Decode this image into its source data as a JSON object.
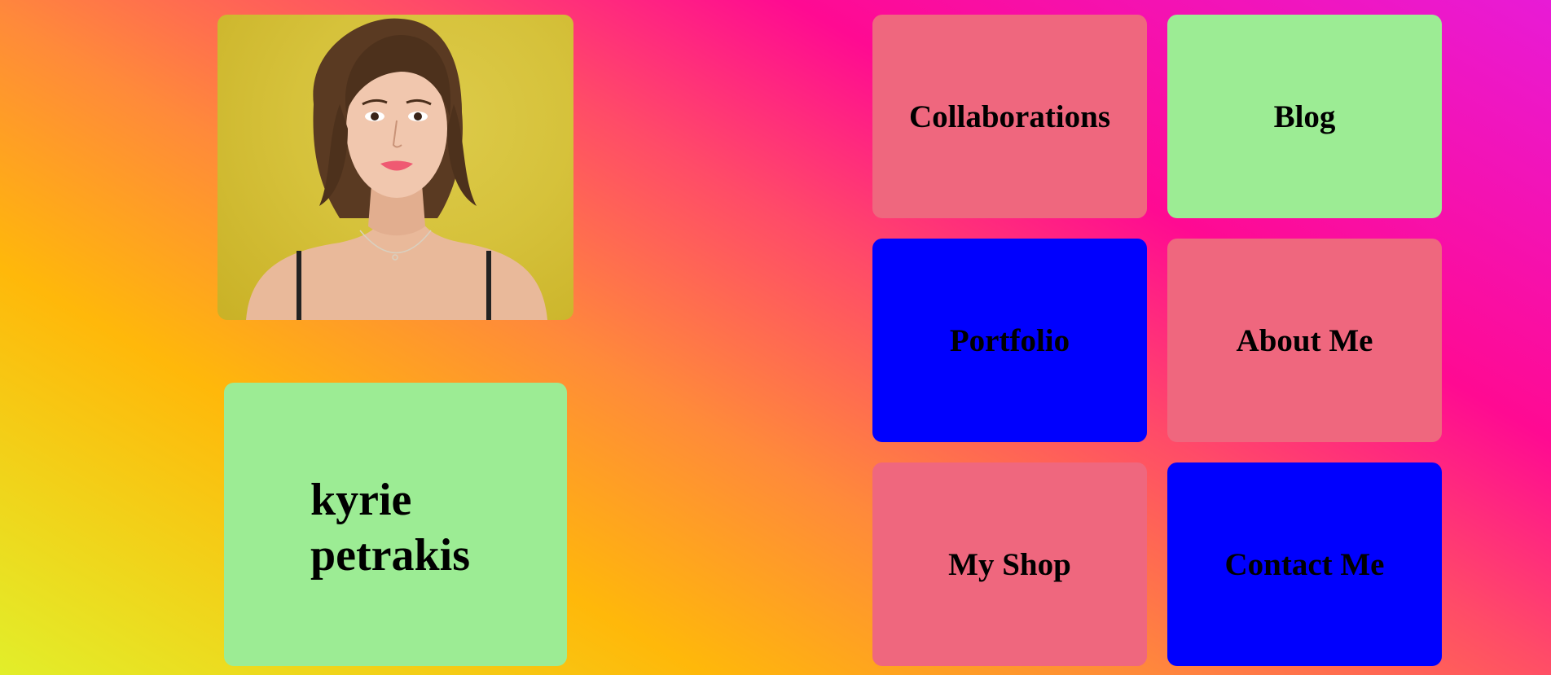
{
  "profile": {
    "name": "kyrie\npetrakis",
    "photo_alt": "portrait-photo"
  },
  "nav": {
    "collaborations": "Collaborations",
    "blog": "Blog",
    "portfolio": "Portfolio",
    "about_me": "About Me",
    "my_shop": "My Shop",
    "contact_me": "Contact Me"
  },
  "colors": {
    "tile_pink": "#ef677e",
    "tile_green": "#9cec94",
    "tile_blue": "#0000fe",
    "background_gradient": [
      "#e2ee2a",
      "#ffb80a",
      "#ff4b68",
      "#ff0a92",
      "#e81bd6"
    ]
  }
}
